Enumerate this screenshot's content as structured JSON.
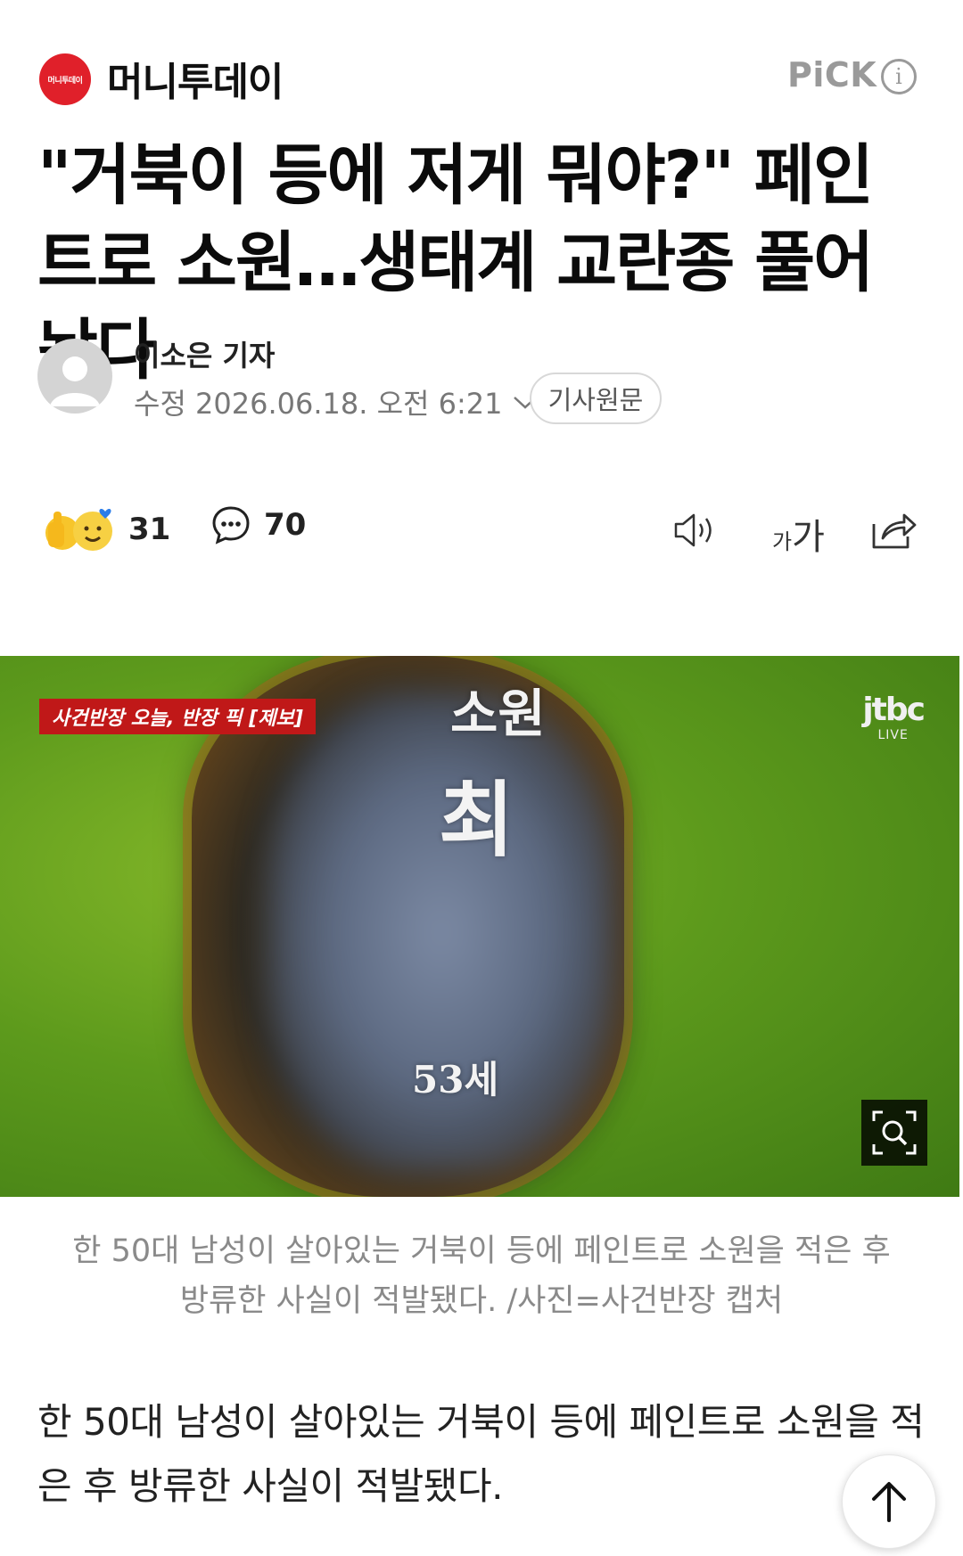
{
  "header": {
    "logo_text": "머니투데이",
    "press_name": "머니투데이",
    "pick_label": "PiCK",
    "info_icon": "info-icon"
  },
  "article": {
    "headline": "\"거북이 등에 저게 뭐야?\" 페인트로 소원…생태계 교란종 풀어놨다",
    "reporter": "이소은 기자",
    "date": "수정 2026.06.18. 오전 6:21",
    "original_link": "기사원문"
  },
  "reactions": {
    "likes": "31",
    "comments": "70"
  },
  "image": {
    "broadcast_tag": "사건반장 오늘, 반장 픽 [제보]",
    "channel_logo": "jtbc",
    "channel_sub": "LIVE",
    "paint_text_top": "소원",
    "paint_text_mid": "최",
    "paint_text_bottom": "53세"
  },
  "caption": "한 50대 남성이 살아있는 거북이 등에 페인트로 소원을 적은 후 방류한 사실이 적발됐다. /사진=사건반장 캡처",
  "body": "한 50대 남성이 살아있는 거북이 등에 페인트로 소원을 적은 후 방류한 사실이 적발됐다.",
  "colors": {
    "brand_red": "#e0202a",
    "muted_gray": "#9a9a9a"
  }
}
